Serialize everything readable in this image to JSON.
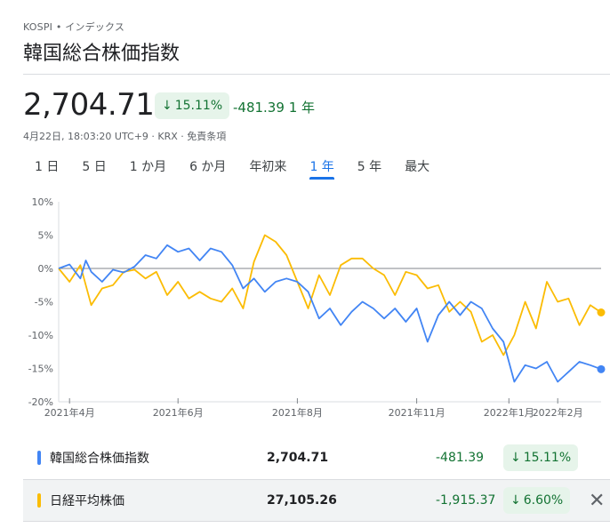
{
  "header": {
    "ticker": "KOSPI • インデックス",
    "title": "韓国総合株価指数"
  },
  "quote": {
    "price": "2,704.71",
    "change_percent": "15.11%",
    "change_value": "-481.39",
    "period": "1 年",
    "meta": "4月22日, 18:03:20 UTC+9 · KRX · 免責条項"
  },
  "tabs": [
    {
      "label": "1 日"
    },
    {
      "label": "5 日"
    },
    {
      "label": "1 か月"
    },
    {
      "label": "6 か月"
    },
    {
      "label": "年初来"
    },
    {
      "label": "1 年",
      "active": true
    },
    {
      "label": "5 年"
    },
    {
      "label": "最大"
    }
  ],
  "chart_data": {
    "type": "line",
    "y_ticks": [
      "10%",
      "5%",
      "0%",
      "-5%",
      "-10%",
      "-15%",
      "-20%"
    ],
    "y_tick_values": [
      10,
      5,
      0,
      -5,
      -10,
      -15,
      -20
    ],
    "ylim": [
      -20,
      10
    ],
    "x_ticks": [
      {
        "label": "2021年4月",
        "t": 0.02
      },
      {
        "label": "2021年6月",
        "t": 0.22
      },
      {
        "label": "2021年8月",
        "t": 0.44
      },
      {
        "label": "2021年11月",
        "t": 0.66
      },
      {
        "label": "2022年1月",
        "t": 0.83
      },
      {
        "label": "2022年2月",
        "t": 0.92
      }
    ],
    "xlim": [
      0,
      1
    ],
    "series": [
      {
        "name": "韓国総合株価指数",
        "color": "#4285f4",
        "points": [
          [
            0,
            0
          ],
          [
            0.02,
            0.6
          ],
          [
            0.04,
            -1.5
          ],
          [
            0.05,
            1.2
          ],
          [
            0.06,
            -0.5
          ],
          [
            0.08,
            -2
          ],
          [
            0.1,
            -0.2
          ],
          [
            0.12,
            -0.6
          ],
          [
            0.14,
            0.3
          ],
          [
            0.16,
            2
          ],
          [
            0.18,
            1.5
          ],
          [
            0.2,
            3.5
          ],
          [
            0.22,
            2.5
          ],
          [
            0.24,
            3
          ],
          [
            0.26,
            1.2
          ],
          [
            0.28,
            3
          ],
          [
            0.3,
            2.5
          ],
          [
            0.32,
            0.5
          ],
          [
            0.34,
            -3
          ],
          [
            0.36,
            -1.5
          ],
          [
            0.38,
            -3.5
          ],
          [
            0.4,
            -2
          ],
          [
            0.42,
            -1.5
          ],
          [
            0.44,
            -2
          ],
          [
            0.46,
            -3.5
          ],
          [
            0.48,
            -7.5
          ],
          [
            0.5,
            -6
          ],
          [
            0.52,
            -8.5
          ],
          [
            0.54,
            -6.5
          ],
          [
            0.56,
            -5
          ],
          [
            0.58,
            -6
          ],
          [
            0.6,
            -7.5
          ],
          [
            0.62,
            -6
          ],
          [
            0.64,
            -8
          ],
          [
            0.66,
            -6
          ],
          [
            0.68,
            -11
          ],
          [
            0.7,
            -7
          ],
          [
            0.72,
            -5
          ],
          [
            0.74,
            -7
          ],
          [
            0.76,
            -5
          ],
          [
            0.78,
            -6
          ],
          [
            0.8,
            -9
          ],
          [
            0.82,
            -11
          ],
          [
            0.84,
            -17
          ],
          [
            0.86,
            -14.5
          ],
          [
            0.88,
            -15
          ],
          [
            0.9,
            -14
          ],
          [
            0.92,
            -17
          ],
          [
            0.94,
            -15.5
          ],
          [
            0.96,
            -14
          ],
          [
            0.98,
            -14.5
          ],
          [
            1,
            -15.11
          ]
        ]
      },
      {
        "name": "日経平均株価",
        "color": "#fbbc04",
        "points": [
          [
            0,
            0
          ],
          [
            0.02,
            -2
          ],
          [
            0.04,
            0.5
          ],
          [
            0.06,
            -5.5
          ],
          [
            0.08,
            -3
          ],
          [
            0.1,
            -2.5
          ],
          [
            0.12,
            -0.5
          ],
          [
            0.14,
            -0.2
          ],
          [
            0.16,
            -1.5
          ],
          [
            0.18,
            -0.5
          ],
          [
            0.2,
            -4
          ],
          [
            0.22,
            -2
          ],
          [
            0.24,
            -4.5
          ],
          [
            0.26,
            -3.5
          ],
          [
            0.28,
            -4.5
          ],
          [
            0.3,
            -5
          ],
          [
            0.32,
            -3
          ],
          [
            0.34,
            -6
          ],
          [
            0.36,
            1
          ],
          [
            0.38,
            5
          ],
          [
            0.4,
            4
          ],
          [
            0.42,
            2
          ],
          [
            0.44,
            -2
          ],
          [
            0.46,
            -6
          ],
          [
            0.48,
            -1
          ],
          [
            0.5,
            -4
          ],
          [
            0.52,
            0.5
          ],
          [
            0.54,
            1.5
          ],
          [
            0.56,
            1.5
          ],
          [
            0.58,
            0
          ],
          [
            0.6,
            -1
          ],
          [
            0.62,
            -4
          ],
          [
            0.64,
            -0.5
          ],
          [
            0.66,
            -1
          ],
          [
            0.68,
            -3
          ],
          [
            0.7,
            -2.5
          ],
          [
            0.72,
            -6.5
          ],
          [
            0.74,
            -5
          ],
          [
            0.76,
            -6.5
          ],
          [
            0.78,
            -11
          ],
          [
            0.8,
            -10
          ],
          [
            0.82,
            -13
          ],
          [
            0.84,
            -10
          ],
          [
            0.86,
            -5
          ],
          [
            0.88,
            -9
          ],
          [
            0.9,
            -2
          ],
          [
            0.92,
            -5
          ],
          [
            0.94,
            -4.5
          ],
          [
            0.96,
            -8.5
          ],
          [
            0.98,
            -5.5
          ],
          [
            1,
            -6.6
          ]
        ]
      }
    ]
  },
  "comparison": [
    {
      "name": "韓国総合株価指数",
      "color": "#4285f4",
      "price": "2,704.71",
      "change": "-481.39",
      "percent": "15.11%"
    },
    {
      "name": "日経平均株価",
      "color": "#fbbc04",
      "price": "27,105.26",
      "change": "-1,915.37",
      "percent": "6.60%",
      "removable": true
    }
  ],
  "icons": {
    "down_arrow": "↓",
    "close": "✕"
  }
}
